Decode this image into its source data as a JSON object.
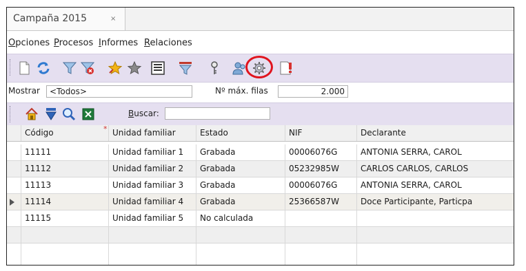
{
  "window": {
    "tab_title": "Campaña 2015",
    "close_glyph": "×"
  },
  "menu": [
    {
      "label": "Opciones",
      "mnemonic": "O",
      "rest": "pciones"
    },
    {
      "label": "Procesos",
      "mnemonic": "P",
      "rest": "rocesos"
    },
    {
      "label": "Informes",
      "mnemonic": "I",
      "rest": "nformes"
    },
    {
      "label": "Relaciones",
      "mnemonic": "R",
      "rest": "elaciones"
    }
  ],
  "toolbar": {
    "icons": [
      "new-document-icon",
      "refresh-icon",
      "filter-icon",
      "clear-filter-icon",
      "favorite-star-icon",
      "star-icon",
      "details-icon",
      "advanced-filter-icon",
      "key-icon",
      "users-icon",
      "settings-gear-icon",
      "document-alert-icon"
    ],
    "highlight_color": "#e0141e"
  },
  "filters": {
    "mostrar_label": "Mostrar",
    "mostrar_value": "<Todos>",
    "max_rows_label": "Nº máx. filas",
    "max_rows_value": "2.000"
  },
  "searchbar": {
    "icons": [
      "home-icon",
      "down-arrow-icon",
      "magnifier-icon",
      "excel-icon"
    ],
    "search_label": "Buscar:",
    "search_mnemonic": "B",
    "search_rest": "uscar:",
    "search_value": ""
  },
  "grid": {
    "columns": [
      "Código",
      "Unidad familiar",
      "Estado",
      "NIF",
      "Declarante"
    ],
    "required_marker": "*",
    "rows": [
      {
        "codigo": "11111",
        "unidad": "Unidad familiar 1",
        "estado": "Grabada",
        "nif": "00006076G",
        "declarante": "ANTONIA SERRA, CAROL"
      },
      {
        "codigo": "11112",
        "unidad": "Unidad familiar 2",
        "estado": "Grabada",
        "nif": "05232985W",
        "declarante": "CARLOS  CARLOS, CARLOS"
      },
      {
        "codigo": "11113",
        "unidad": "Unidad familiar 3",
        "estado": "Grabada",
        "nif": "00006076G",
        "declarante": "ANTONIA SERRA, CAROL"
      },
      {
        "codigo": "11114",
        "unidad": "Unidad familiar 4",
        "estado": "Grabada",
        "nif": "25366587W",
        "declarante": "Doce Participante, Particpa"
      },
      {
        "codigo": "11115",
        "unidad": "Unidad familiar 5",
        "estado": "No calculada",
        "nif": "",
        "declarante": ""
      }
    ],
    "current_row": 3
  },
  "colors": {
    "toolbar_bg": "#e5dff0",
    "alt_row": "#efefef",
    "frame_border": "#222222"
  }
}
